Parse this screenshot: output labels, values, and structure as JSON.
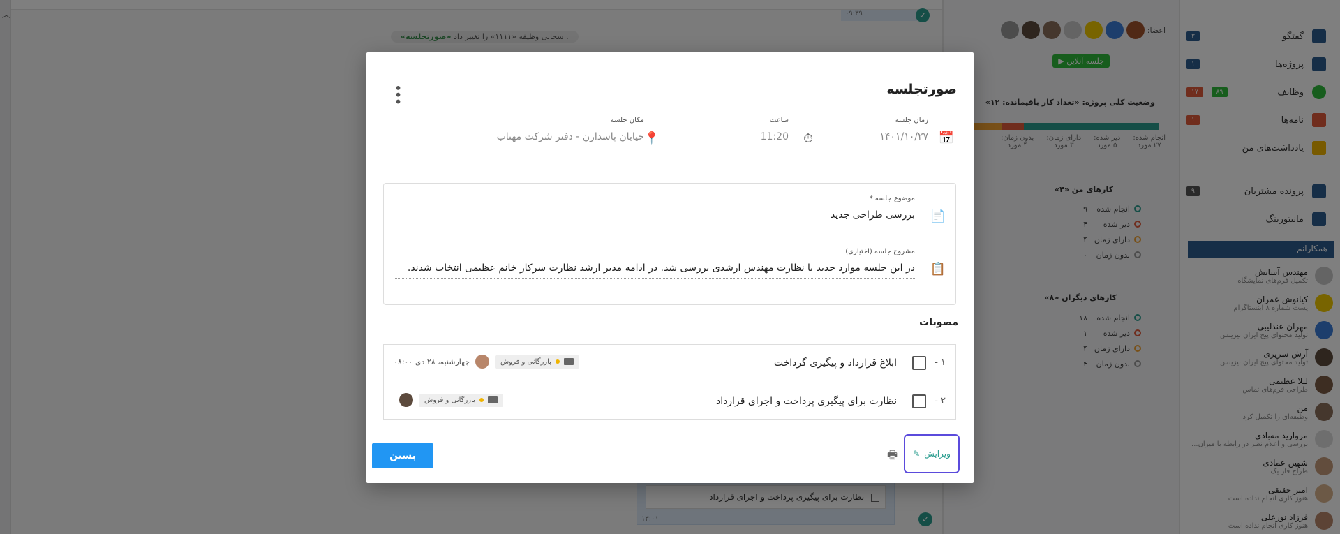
{
  "background": {
    "system_message_prefix": ". سحابی وظیفه «۱۱۱۱» را تغییر داد",
    "system_message_bold": "«صورتجلسه»",
    "red_text": "...",
    "time_top": "۰۹:۳۹",
    "bottom_card_text": "نظارت برای پیگیری پرداخت و اجرای قرارداد",
    "bottom_card_time": "۱۳:۰۱"
  },
  "project": {
    "members_label": "اعضا:",
    "online_button": "جلسه آنلاین",
    "status_title": "وضعیت کلی پروژه: «تعداد کار باقیمانده: ۱۲»",
    "progress_percents": [
      "۶۱٪",
      "۱۱٪",
      "۱۶٪",
      "۱۲٪"
    ],
    "stats": [
      {
        "label": "انجام شده:",
        "value": "۲۷ مورد"
      },
      {
        "label": "دیر شده:",
        "value": "۵ مورد"
      },
      {
        "label": "دارای زمان:",
        "value": "۳ مورد"
      },
      {
        "label": "بدون زمان:",
        "value": "۴ مورد"
      }
    ],
    "my_tasks_title": "کارهای من «۴»",
    "my_tasks": [
      {
        "label": "انجام شده",
        "value": "۹",
        "color": "#2a9d8f"
      },
      {
        "label": "دیر شده",
        "value": "۴",
        "color": "#e05a3a"
      },
      {
        "label": "دارای زمان",
        "value": "۴",
        "color": "#f0a030"
      },
      {
        "label": "بدون زمان",
        "value": "۰",
        "color": "#999999"
      }
    ],
    "others_tasks_title": "کارهای دیگران «۸»",
    "others_tasks": [
      {
        "label": "انجام شده",
        "value": "۱۸",
        "color": "#2a9d8f"
      },
      {
        "label": "دیر شده",
        "value": "۱",
        "color": "#e05a3a"
      },
      {
        "label": "دارای زمان",
        "value": "۴",
        "color": "#f0a030"
      },
      {
        "label": "بدون زمان",
        "value": "۴",
        "color": "#999999"
      }
    ]
  },
  "sidebar": {
    "items": [
      {
        "label": "گفتگو",
        "badge": "۳",
        "badge_color": "#2c5d8f",
        "icon_color": "#2c5d8f"
      },
      {
        "label": "پروژه‌ها",
        "badge": "۱",
        "badge_color": "#2c5d8f",
        "icon_color": "#2c5d8f"
      },
      {
        "label": "وظایف",
        "badge": "۸۹",
        "badge2": "۱۷",
        "badge_color": "#2ebb3a",
        "icon_color": "#2ebb3a"
      },
      {
        "label": "نامه‌ها",
        "badge": "۱",
        "badge_color": "#e05a3a",
        "icon_color": "#e05a3a"
      },
      {
        "label": "یادداشت‌های من",
        "badge": "",
        "badge_color": "",
        "icon_color": "#f0b400"
      },
      {
        "label": "پرونده مشتریان",
        "badge": "۹",
        "badge_color": "#555555",
        "icon_color": "#2c5d8f"
      },
      {
        "label": "مانیتورینگ",
        "badge": "",
        "badge_color": "",
        "icon_color": "#2c5d8f"
      }
    ],
    "colleagues_header": "همکارانم",
    "colleagues": [
      {
        "name": "مهندس آسایش",
        "sub": "تکمیل فرم‌های نمایشگاه"
      },
      {
        "name": "کیانوش عمران",
        "sub": "پست شماره ۸ اینستاگرام"
      },
      {
        "name": "مهران عندلیبی",
        "sub": "تولید محتوای پیج ایران بیزینس"
      },
      {
        "name": "آرش سریری",
        "sub": "تولید محتوای پیج ایران بیزینس"
      },
      {
        "name": "لیلا عظیمی",
        "sub": "طراحی فرم‌های تماس"
      },
      {
        "name": "من",
        "sub": "وظیفه‌ای را تکمیل کرد"
      },
      {
        "name": "مروارید مه‌بادی",
        "sub": "بررسی و اعلام نظر در رابطه با میزان..."
      },
      {
        "name": "شهین عمادی",
        "sub": "طراح فاز یک"
      },
      {
        "name": "امیر حقیقی",
        "sub": "هنوز کاری انجام نداده است"
      },
      {
        "name": "فرزاد نورعلی",
        "sub": "هنوز کاری انجام نداده است"
      }
    ]
  },
  "modal": {
    "title": "صورتجلسه",
    "meeting_time_label": "زمان جلسه",
    "meeting_time_value": "۱۴۰۱/۱۰/۲۷",
    "hour_label": "ساعت",
    "hour_value": "11:20",
    "place_label": "مکان جلسه",
    "place_value": "خیابان پاسدارن - دفتر شرکت مهتاب",
    "subject_label": "موضوع جلسه *",
    "subject_value": "بررسی طراحی جدید",
    "description_label": "مشروح جلسه (اختیاری)",
    "description_value": "در این جلسه موارد جدید با نظارت مهندس ارشدی بررسی شد. در ادامه مدیر ارشد نظارت سرکار خانم عظیمی انتخاب شدند.",
    "resolutions_header": "مصوبات",
    "resolutions": [
      {
        "num": "۱ -",
        "text": "ابلاغ قرارداد و پیگیری گرداخت",
        "tag": "بازرگانی و فروش",
        "date": "چهارشنبه، ۲۸ دی ۰۸:۰۰"
      },
      {
        "num": "۲ -",
        "text": "نظارت برای پیگیری پرداخت و اجرای قرارداد",
        "tag": "بازرگانی و فروش",
        "date": ""
      }
    ],
    "edit_label": "ویرایش",
    "close_label": "بستن"
  }
}
